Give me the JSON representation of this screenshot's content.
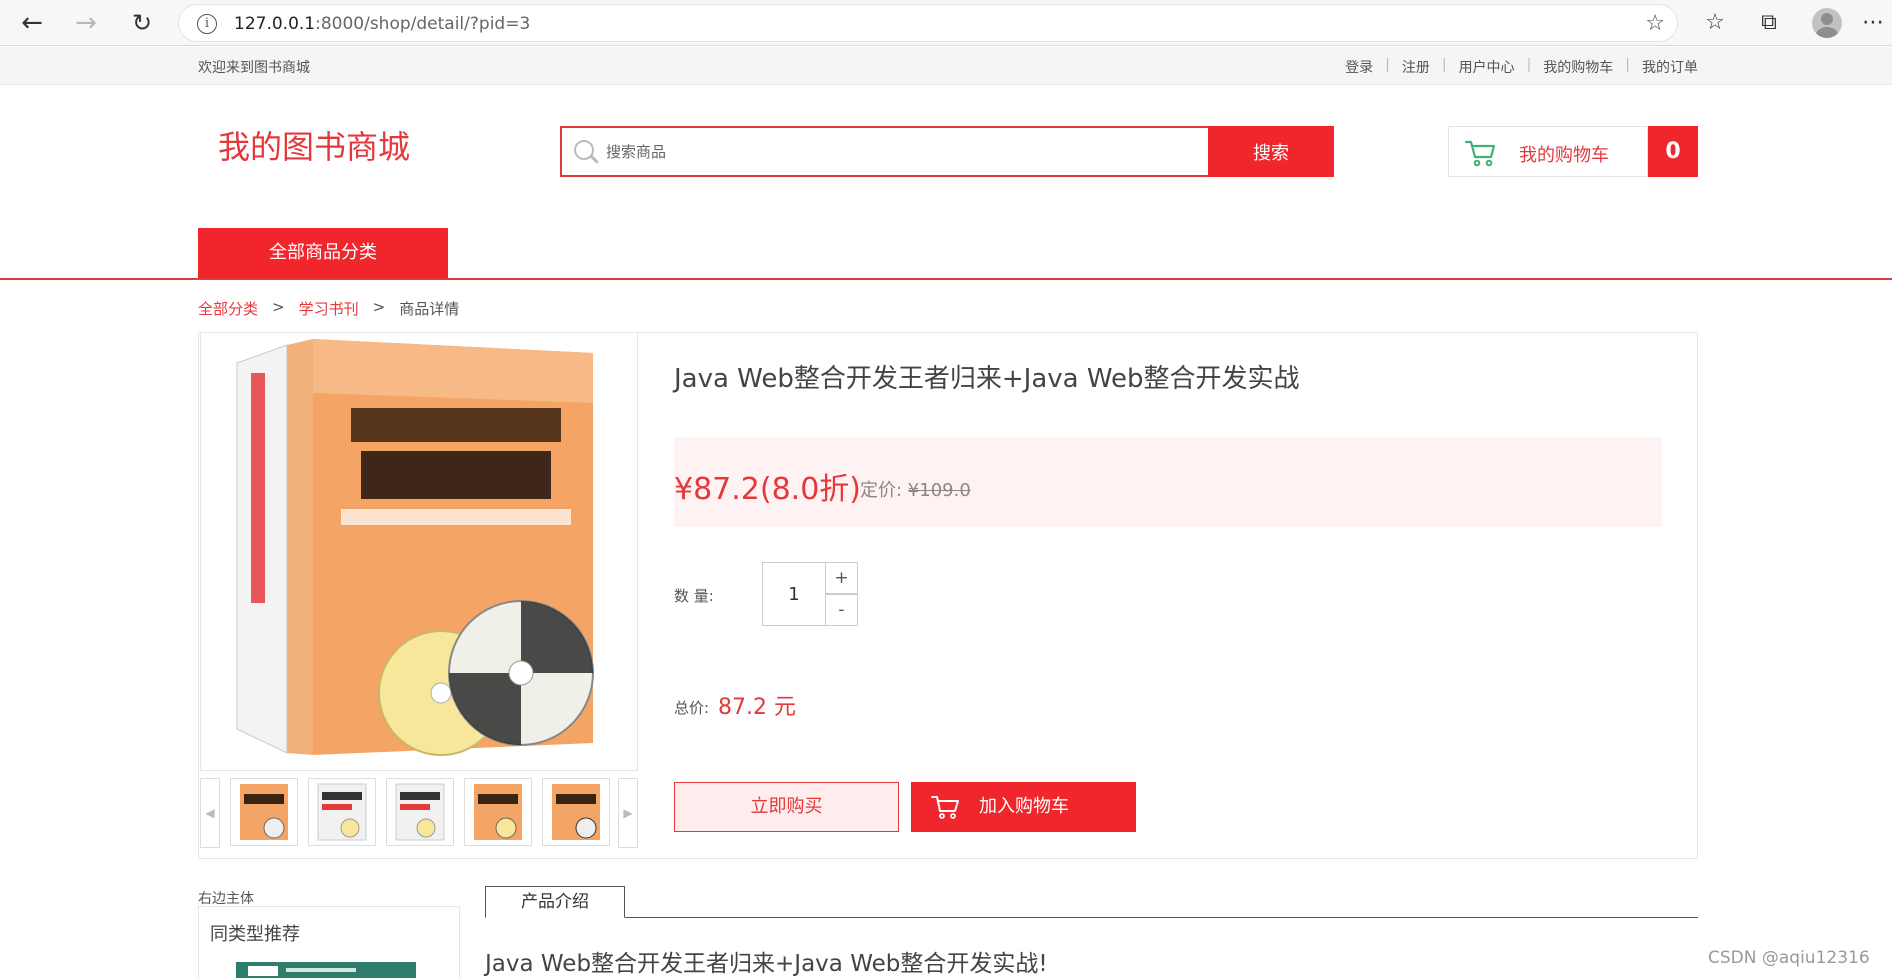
{
  "browser": {
    "url_host": "127.0.0.1",
    "url_rest": ":8000/shop/detail/?pid=3"
  },
  "topbar": {
    "welcome": "欢迎来到图书商城",
    "links": [
      "登录",
      "注册",
      "用户中心",
      "我的购物车",
      "我的订单"
    ]
  },
  "header": {
    "logo": "我的图书商城",
    "search_placeholder": "搜索商品",
    "search_button": "搜索",
    "cart_label": "我的购物车",
    "cart_count": "0",
    "category_button": "全部商品分类"
  },
  "breadcrumb": {
    "items": [
      "全部分类",
      "学习书刊"
    ],
    "current": "商品详情",
    "separator": ">"
  },
  "product": {
    "title": "Java Web整合开发王者归来+Java Web整合开发实战",
    "price": "¥87.2(8.0折)",
    "list_price_label": "定价: ",
    "list_price": "¥109.0",
    "qty_label": "数 量:",
    "qty_value": "1",
    "qty_plus": "+",
    "qty_minus": "-",
    "total_label": "总价:",
    "total_value": "87.2 元",
    "buy_now": "立即购买",
    "add_to_cart": "加入购物车",
    "thumbnail_count": 5
  },
  "bottom": {
    "sidebar_caption": "右边主体",
    "sidebar_title": "同类型推荐",
    "tab_intro": "产品介绍",
    "intro_text": "Java Web整合开发王者归来+Java Web整合开发实战!"
  },
  "watermark": "CSDN @aqiu12316",
  "colors": {
    "accent": "#f1262d",
    "link_red": "#e4393c",
    "price_bg": "#fff2f2"
  }
}
